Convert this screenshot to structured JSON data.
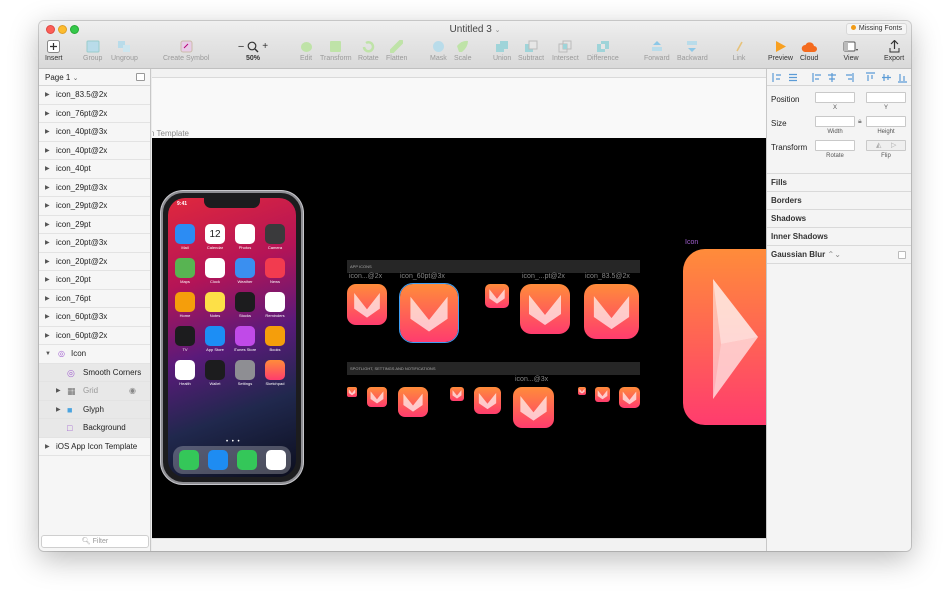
{
  "window": {
    "title": "Untitled 3",
    "missing_fonts": "Missing Fonts"
  },
  "toolbar": {
    "insert": "Insert",
    "group": "Group",
    "ungroup": "Ungroup",
    "create_symbol": "Create Symbol",
    "zoom": "50%",
    "zoom_minus": "−",
    "zoom_plus": "+",
    "edit": "Edit",
    "transform": "Transform",
    "rotate": "Rotate",
    "flatten": "Flatten",
    "mask": "Mask",
    "scale": "Scale",
    "union": "Union",
    "subtract": "Subtract",
    "intersect": "Intersect",
    "difference": "Difference",
    "forward": "Forward",
    "backward": "Backward",
    "link": "Link",
    "preview": "Preview",
    "cloud": "Cloud",
    "view": "View",
    "export": "Export"
  },
  "sidebar": {
    "page": "Page 1",
    "layers": [
      {
        "label": "icon_83.5@2x"
      },
      {
        "label": "icon_76pt@2x"
      },
      {
        "label": "icon_40pt@3x"
      },
      {
        "label": "icon_40pt@2x"
      },
      {
        "label": "icon_40pt"
      },
      {
        "label": "icon_29pt@3x"
      },
      {
        "label": "icon_29pt@2x"
      },
      {
        "label": "icon_29pt"
      },
      {
        "label": "icon_20pt@3x"
      },
      {
        "label": "icon_20pt@2x"
      },
      {
        "label": "icon_20pt"
      },
      {
        "label": "icon_76pt"
      },
      {
        "label": "icon_60pt@3x"
      },
      {
        "label": "icon_60pt@2x"
      },
      {
        "label": "Icon"
      }
    ],
    "icon_children": [
      {
        "label": "Smooth Corners"
      },
      {
        "label": "Grid"
      },
      {
        "label": "Glyph"
      },
      {
        "label": "Background"
      }
    ],
    "template": "iOS App Icon Template",
    "filter_placeholder": "Filter"
  },
  "canvas": {
    "artboard_label": "n Template",
    "band1": "APP ICONS",
    "band2": "SPOTLIGHT, SETTINGS AND NOTIFICATIONS",
    "label_a": "icon...@2x",
    "label_b": "icon_60pt@3x",
    "label_c": "icon_...pt@2x",
    "label_d": "icon_83.5@2x",
    "label_e": "icon...@3x",
    "label_icon": "Icon",
    "phone": {
      "time": "9:41",
      "apps": [
        "Mail",
        "Calendar",
        "Photos",
        "Camera",
        "Maps",
        "Clock",
        "Weather",
        "News",
        "Home",
        "Notes",
        "Stocks",
        "Reminders",
        "TV",
        "App Store",
        "iTunes Store",
        "Books",
        "Health",
        "Wallet",
        "Settings",
        "Sketchpad"
      ],
      "calendar_day": "12"
    }
  },
  "inspector": {
    "position": "Position",
    "x": "X",
    "y": "Y",
    "size": "Size",
    "width": "Width",
    "height": "Height",
    "transform": "Transform",
    "rotate": "Rotate",
    "flip": "Flip",
    "fills": "Fills",
    "borders": "Borders",
    "shadows": "Shadows",
    "inner_shadows": "Inner Shadows",
    "gaussian_blur": "Gaussian Blur"
  },
  "colors": {
    "icon_top": "#ff8c3a",
    "icon_bottom": "#ff3c6e",
    "selection": "#3d9ff5"
  }
}
